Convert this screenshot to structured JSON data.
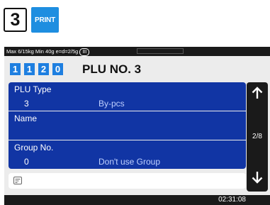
{
  "step": {
    "number": "3",
    "key_label": "PRINT"
  },
  "status": {
    "spec": "Max 6/15kg Min 40g e=d=2/5g",
    "weigh_badge": "III"
  },
  "header": {
    "plu_digits": [
      "1",
      "1",
      "2",
      "0"
    ],
    "title": "PLU NO. 3"
  },
  "fields": [
    {
      "label": "PLU Type",
      "value": "3",
      "text": "By-pcs"
    },
    {
      "label": "Name",
      "value": "",
      "text": ""
    },
    {
      "label": "Group No.",
      "value": "0",
      "text": "Don't use Group"
    }
  ],
  "memo": {
    "icon": "memo-icon",
    "value": ""
  },
  "sidebar": {
    "up_icon": "arrow-up-icon",
    "down_icon": "arrow-down-icon",
    "page": "2/8"
  },
  "footer": {
    "time": "02:31:08"
  },
  "colors": {
    "field_bg": "#1135a4",
    "digit_bg": "#1e7fe0",
    "print_key_bg": "#1e8ee0",
    "bar_bg": "#1a1a1a"
  }
}
